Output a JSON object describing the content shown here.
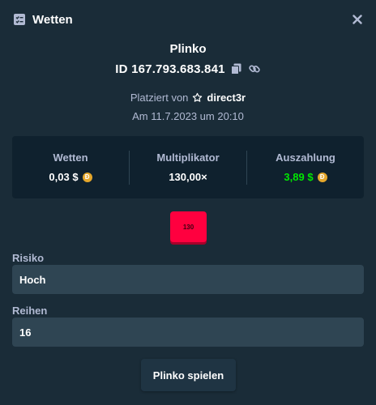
{
  "header": {
    "title": "Wetten",
    "icon": "bet-slip-icon",
    "close_icon": "close-icon"
  },
  "bet": {
    "game": "Plinko",
    "id": "ID 167.793.683.841",
    "placed_by_label": "Platziert von",
    "username": "direct3r",
    "date": "Am 11.7.2023 um 20:10"
  },
  "stats": {
    "wager_label": "Wetten",
    "wager_value": "0,03 $",
    "multiplier_label": "Multiplikator",
    "multiplier_value": "130,00×",
    "payout_label": "Auszahlung",
    "payout_value": "3,89 $",
    "currency_icon": "dogecoin-icon",
    "payout_color": "#00e701"
  },
  "result": {
    "multiplier": "130",
    "color": "#ff003f"
  },
  "fields": {
    "risk_label": "Risiko",
    "risk_value": "Hoch",
    "rows_label": "Reihen",
    "rows_value": "16"
  },
  "play_button": "Plinko spielen"
}
